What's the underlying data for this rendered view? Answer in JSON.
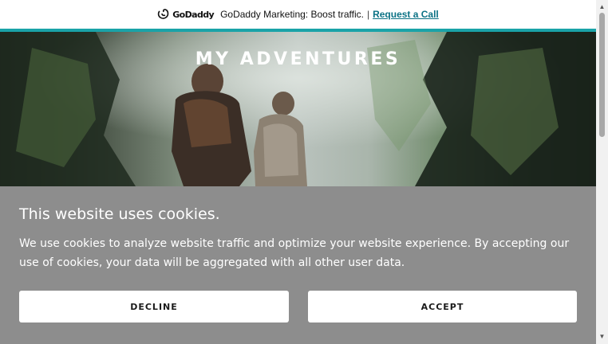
{
  "promo": {
    "logo_text": "GoDaddy",
    "message": "GoDaddy Marketing: Boost traffic.",
    "separator": "|",
    "link_label": "Request a Call"
  },
  "hero": {
    "title": "MY ADVENTURES"
  },
  "cookie": {
    "title": "This website uses cookies.",
    "body": "We use cookies to analyze website traffic and optimize your website experience. By accepting our use of cookies, your data will be aggregated with all other user data.",
    "decline_label": "DECLINE",
    "accept_label": "ACCEPT"
  },
  "colors": {
    "accent": "#1aa3a8",
    "overlay": "#8d8d8d",
    "link": "#0b7285"
  },
  "scrollbar": {
    "up_icon": "▲",
    "down_icon": "▼"
  }
}
